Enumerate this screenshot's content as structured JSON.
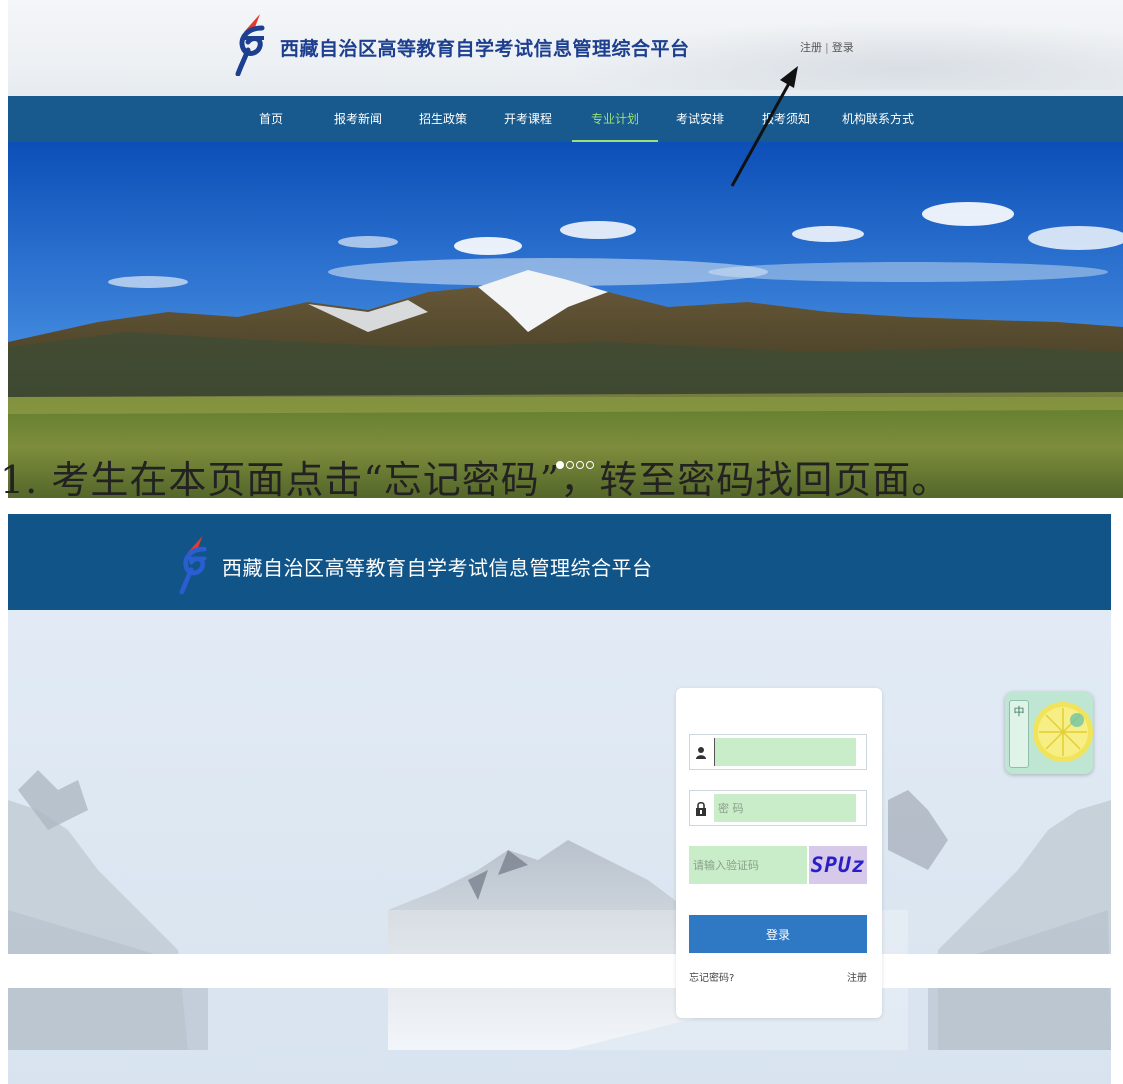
{
  "portal": {
    "site_title": "西藏自治区高等教育自学考试信息管理综合平台",
    "auth": {
      "register": "注册",
      "separator": "|",
      "login": "登录"
    },
    "nav": [
      {
        "label": "首页"
      },
      {
        "label": "报考新闻"
      },
      {
        "label": "招生政策"
      },
      {
        "label": "开考课程"
      },
      {
        "label": "专业计划",
        "active": true
      },
      {
        "label": "考试安排"
      },
      {
        "label": "报考须知"
      },
      {
        "label": "机构联系方式"
      }
    ],
    "carousel": {
      "slides": 4,
      "current": 1
    }
  },
  "instruction": "1. 考生在本页面点击“忘记密码”，转至密码找回页面。",
  "login_page": {
    "site_title": "西藏自治区高等教育自学考试信息管理综合平台",
    "form": {
      "username_value": "",
      "password_placeholder": "密 码",
      "captcha_placeholder": "请输入验证码",
      "captcha_code": "SPUz",
      "login_button": "登录",
      "forgot_link": "忘记密码?",
      "register_link": "注册"
    },
    "ime_widget": {
      "label": "中",
      "icon": "lemon-icon"
    }
  },
  "colors": {
    "nav_bg": "#185a8d",
    "header_bg": "#115488",
    "active_nav": "#9be07a",
    "login_button": "#2f78c4",
    "input_fill": "#c9ecc9",
    "captcha_bg": "#d7c9ea",
    "captcha_text": "#2a1fc4"
  }
}
